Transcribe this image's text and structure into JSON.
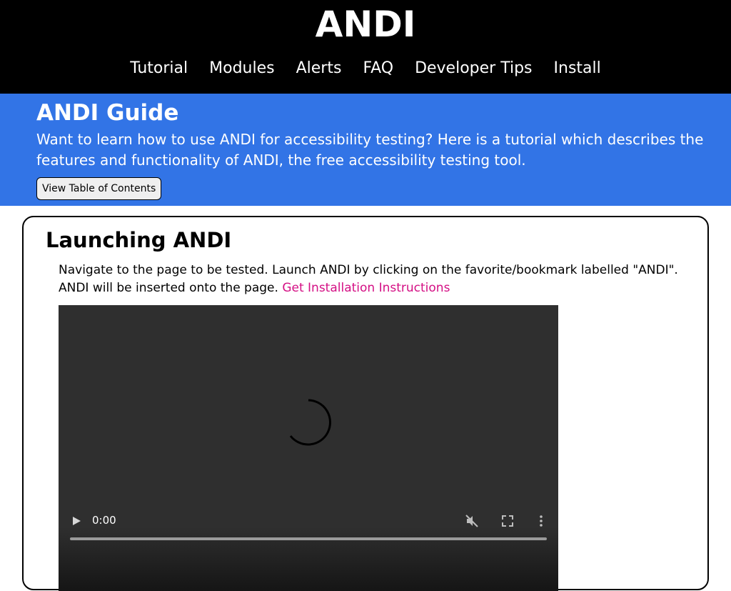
{
  "site": {
    "title": "ANDI"
  },
  "nav": {
    "items": [
      {
        "label": "Tutorial"
      },
      {
        "label": "Modules"
      },
      {
        "label": "Alerts"
      },
      {
        "label": "FAQ"
      },
      {
        "label": "Developer Tips"
      },
      {
        "label": "Install"
      }
    ]
  },
  "guide": {
    "title": "ANDI Guide",
    "description": "Want to learn how to use ANDI for accessibility testing? Here is a tutorial which describes the features and functionality of ANDI, the free accessibility testing tool.",
    "toc_button": "View Table of Contents"
  },
  "section": {
    "title": "Launching ANDI",
    "text": "Navigate to the page to be tested. Launch ANDI by clicking on the favorite/bookmark labelled \"ANDI\". ANDI will be inserted onto the page.",
    "link": "Get Installation Instructions"
  },
  "video": {
    "time": "0:00",
    "icons": [
      "play-icon",
      "muted-icon",
      "fullscreen-icon",
      "more-options-icon",
      "loading-spinner-icon"
    ]
  },
  "colors": {
    "header_bg": "#000000",
    "guide_bg": "#3274e6",
    "link": "#d40f84"
  }
}
